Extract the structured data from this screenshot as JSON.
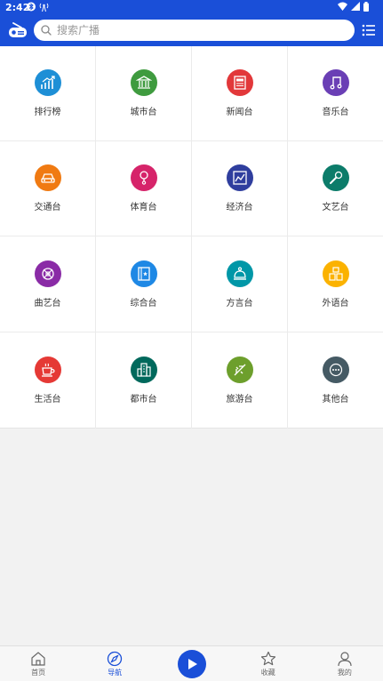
{
  "status_bar": {
    "time": "2:42"
  },
  "search": {
    "placeholder": "搜索广播"
  },
  "categories": [
    {
      "label": "排行榜",
      "icon": "chart-up-icon",
      "color": "#1e8fd6"
    },
    {
      "label": "城市台",
      "icon": "building-icon",
      "color": "#3f9b3f"
    },
    {
      "label": "新闻台",
      "icon": "newspaper-icon",
      "color": "#e2383a"
    },
    {
      "label": "音乐台",
      "icon": "music-note-icon",
      "color": "#6a3fb5"
    },
    {
      "label": "交通台",
      "icon": "car-icon",
      "color": "#f07a12"
    },
    {
      "label": "体育台",
      "icon": "sports-icon",
      "color": "#d6246a"
    },
    {
      "label": "经济台",
      "icon": "economy-chart-icon",
      "color": "#2f3e9e"
    },
    {
      "label": "文艺台",
      "icon": "microphone-icon",
      "color": "#0c7c6a"
    },
    {
      "label": "曲艺台",
      "icon": "opera-icon",
      "color": "#8a2ba6"
    },
    {
      "label": "综合台",
      "icon": "book-icon",
      "color": "#1e88e5"
    },
    {
      "label": "方言台",
      "icon": "bell-icon",
      "color": "#0097a7"
    },
    {
      "label": "外语台",
      "icon": "language-icon",
      "color": "#fbb200"
    },
    {
      "label": "生活台",
      "icon": "cup-icon",
      "color": "#e53935"
    },
    {
      "label": "都市台",
      "icon": "city-icon",
      "color": "#00695c"
    },
    {
      "label": "旅游台",
      "icon": "plane-icon",
      "color": "#6d9f2c"
    },
    {
      "label": "其他台",
      "icon": "more-dots-icon",
      "color": "#455a64"
    }
  ],
  "bottom_nav": {
    "home": "首页",
    "navigate": "导航",
    "favorites": "收藏",
    "mine": "我的"
  },
  "colors": {
    "primary": "#1a4fd8"
  }
}
